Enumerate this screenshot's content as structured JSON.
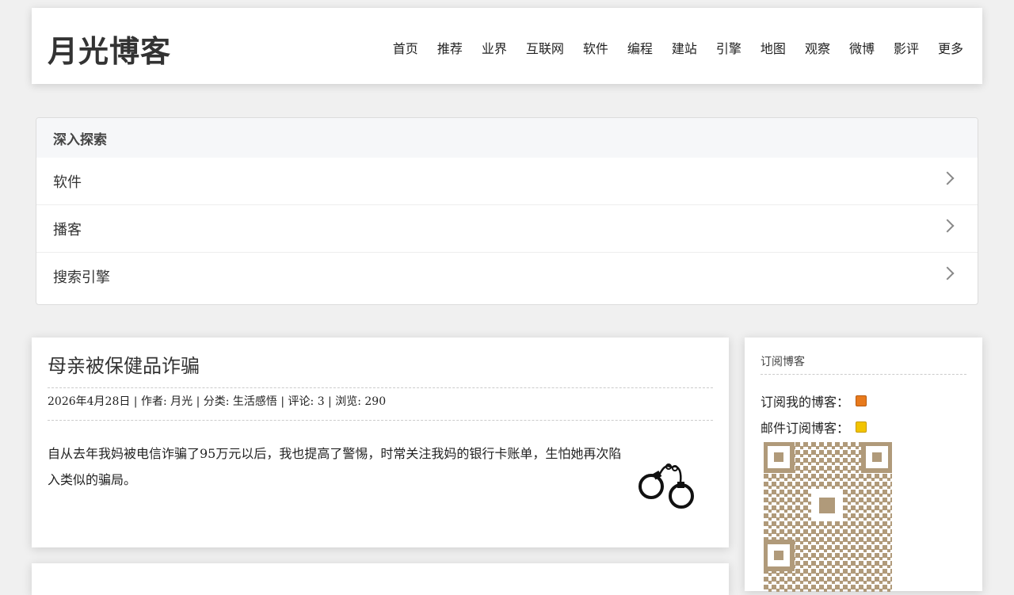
{
  "header": {
    "site_title": "月光博客",
    "nav": [
      "首页",
      "推荐",
      "业界",
      "互联网",
      "软件",
      "编程",
      "建站",
      "引擎",
      "地图",
      "观察",
      "微博",
      "影评",
      "更多"
    ]
  },
  "explore": {
    "heading": "深入探索",
    "items": [
      "软件",
      "播客",
      "搜索引擎"
    ]
  },
  "post": {
    "title": "母亲被保健品诈骗",
    "meta": "2026年4月28日 | 作者: 月光 | 分类: 生活感悟 | 评论: 3 | 浏览: 290",
    "body": "自从去年我妈被电信诈骗了95万元以后，我也提高了警惕，时常关注我妈的银行卡账单，生怕她再次陷入类似的骗局。",
    "image_icon": "handcuffs-icon"
  },
  "sidebar": {
    "title": "订阅博客",
    "rss_label": "订阅我的博客：",
    "mail_label": "邮件订阅博客：",
    "rss_icon": "rss-icon",
    "mail_icon": "mail-icon",
    "qr_icon": "qr-code-icon"
  },
  "colors": {
    "background": "#f0f0f0",
    "panel": "#ffffff",
    "rss": "#e87a1c",
    "mail": "#f2c400",
    "qr": "#b09a7a"
  }
}
